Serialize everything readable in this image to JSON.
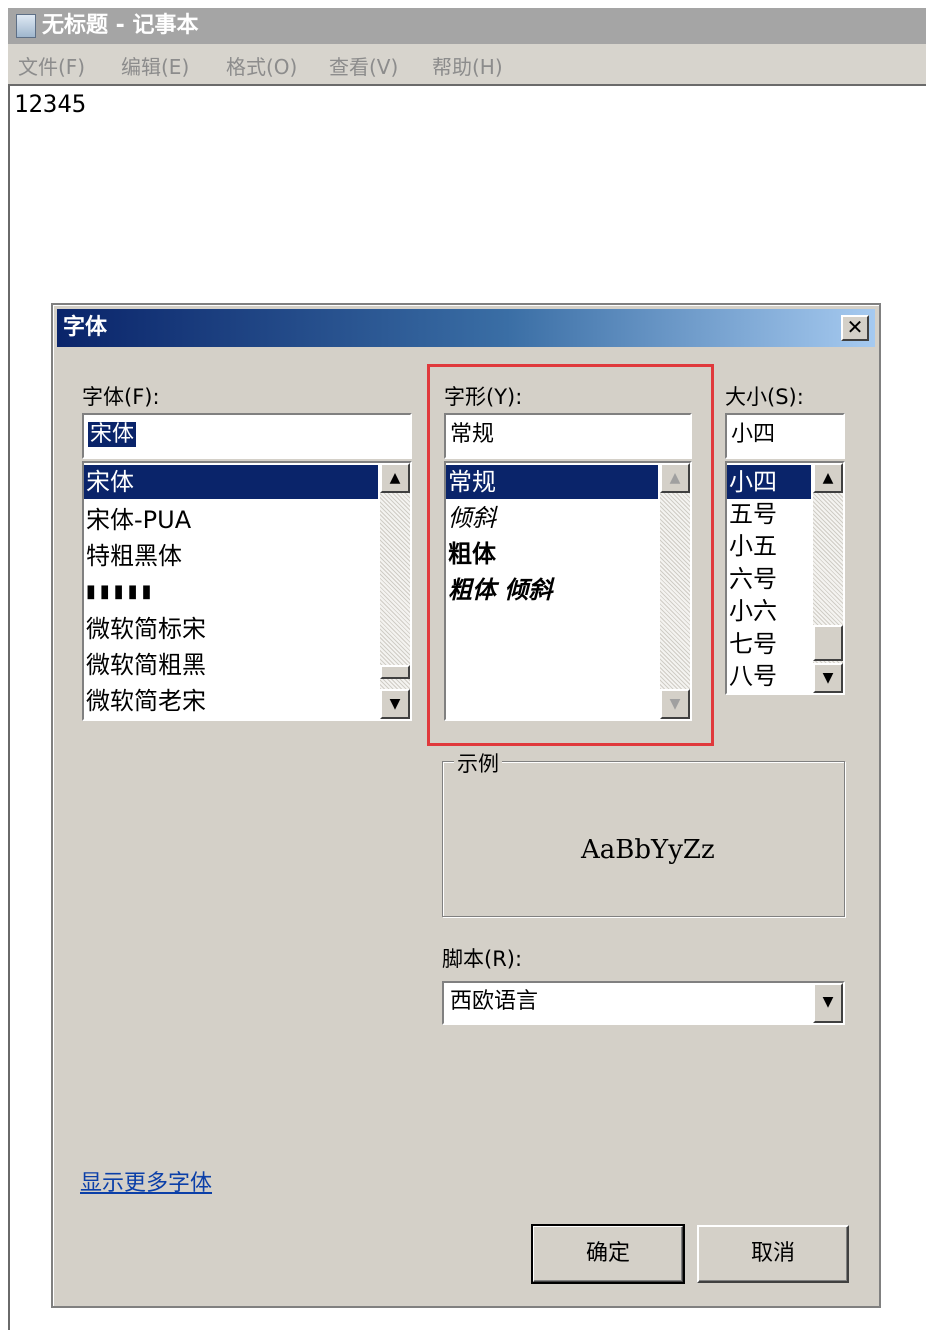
{
  "notepad": {
    "title": "无标题 - 记事本",
    "menu": [
      "文件(F)",
      "编辑(E)",
      "格式(O)",
      "查看(V)",
      "帮助(H)"
    ],
    "content": "12345"
  },
  "dialog": {
    "title": "字体",
    "close_label": "✕",
    "font": {
      "label": "字体(F):",
      "value": "宋体",
      "items": [
        "宋体",
        "宋体-PUA",
        "特粗黑体",
        "▮▮▮▮▮",
        "微软简标宋",
        "微软简粗黑",
        "微软简老宋"
      ],
      "selected_index": 0
    },
    "style": {
      "label": "字形(Y):",
      "value": "常规",
      "items": [
        "常规",
        "倾斜",
        "粗体",
        "粗体 倾斜"
      ],
      "selected_index": 0
    },
    "size": {
      "label": "大小(S):",
      "value": "小四",
      "items": [
        "小四",
        "五号",
        "小五",
        "六号",
        "小六",
        "七号",
        "八号"
      ],
      "selected_index": 0
    },
    "sample": {
      "label": "示例",
      "text": "AaBbYyZz"
    },
    "script": {
      "label": "脚本(R):",
      "value": "西欧语言"
    },
    "more_fonts_link": "显示更多字体",
    "ok_label": "确定",
    "cancel_label": "取消"
  },
  "colors": {
    "dialog_bg": "#d4d0c8",
    "selection": "#0a246a",
    "highlight_box": "#e0393c",
    "link": "#0b3fa8"
  }
}
